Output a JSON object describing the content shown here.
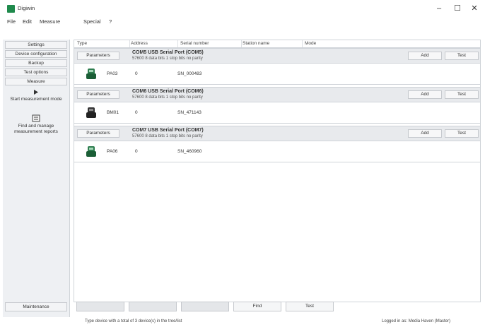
{
  "window": {
    "title": "Digiwin",
    "minimize": "–",
    "maximize": "☐",
    "close": "✕"
  },
  "menu": [
    "File",
    "Edit",
    "Measure",
    "Special",
    "?"
  ],
  "sidebar": {
    "items": [
      {
        "label": "Settings",
        "type": "button"
      },
      {
        "label": "Device configuration",
        "type": "button"
      },
      {
        "label": "Backup",
        "type": "button"
      },
      {
        "label": "Test options",
        "type": "button"
      },
      {
        "label": "Measure",
        "type": "button"
      }
    ],
    "start_measurement": {
      "label": "Start measurement mode",
      "icon": "play-icon"
    },
    "find_reports": {
      "label": "Find and manage measurement reports",
      "icon": "report-icon"
    },
    "bottom_button": "Maintenance"
  },
  "table": {
    "columns": [
      "Type",
      "Address",
      "Serial number",
      "Station name",
      "Mode"
    ],
    "groups": [
      {
        "params": "Parameters",
        "port": "COM5 USB Serial Port (COM5)",
        "port_sub": "57600 8 data bits 1 stop bits no parity",
        "add": "Add",
        "test": "Test",
        "device": {
          "name": "PA03",
          "address": "0",
          "serial": "SN_000483"
        }
      },
      {
        "params": "Parameters",
        "port": "COM6 USB Serial Port (COM6)",
        "port_sub": "57600 8 data bits 1 stop bits no parity",
        "add": "Add",
        "test": "Test",
        "device": {
          "name": "BM01",
          "address": "0",
          "serial": "SN_471143"
        }
      },
      {
        "params": "Parameters",
        "port": "COM7 USB Serial Port (COM7)",
        "port_sub": "57600 8 data bits 1 stop bits no parity",
        "add": "Add",
        "test": "Test",
        "device": {
          "name": "PA06",
          "address": "0",
          "serial": "SN_460960"
        }
      }
    ]
  },
  "bottom_buttons": [
    {
      "label": "",
      "state": "disabled"
    },
    {
      "label": "",
      "state": "disabled"
    },
    {
      "label": "",
      "state": "disabled"
    },
    {
      "label": "Find",
      "state": "enabled"
    },
    {
      "label": "Test",
      "state": "enabled"
    }
  ],
  "status": {
    "left": "Type device with a total of 3 device(s) in the tree/list",
    "right": "Logged in as: Media Haven (Master)"
  },
  "colors": {
    "accent": "#1f8a4c",
    "header_bg": "#e8eaed"
  }
}
